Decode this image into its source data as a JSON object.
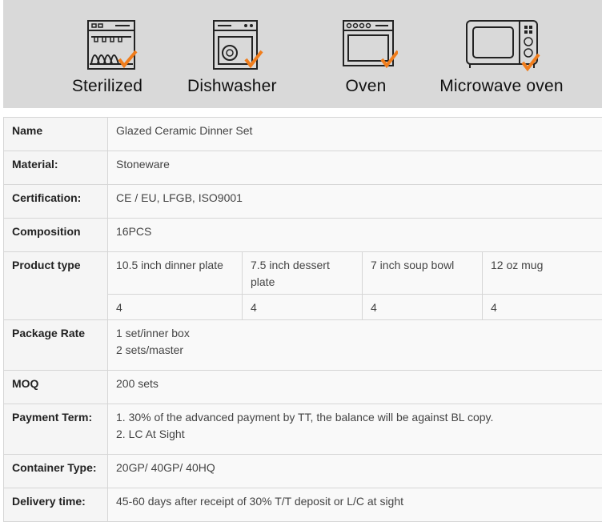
{
  "banner": {
    "features": [
      {
        "label": "Sterilized",
        "icon": "sterilizer-icon"
      },
      {
        "label": "Dishwasher",
        "icon": "dishwasher-icon"
      },
      {
        "label": "Oven",
        "icon": "oven-icon"
      },
      {
        "label": "Microwave oven",
        "icon": "microwave-icon"
      }
    ],
    "check_color": "#f07d1c"
  },
  "specs": {
    "name": {
      "key": "Name",
      "value": "Glazed Ceramic Dinner Set"
    },
    "material": {
      "key": "Material:",
      "value": "Stoneware"
    },
    "certification": {
      "key": "Certification:",
      "value": "CE / EU, LFGB, ISO9001"
    },
    "composition": {
      "key": "Composition",
      "value": "16PCS"
    },
    "product_type": {
      "key": "Product type",
      "items": [
        {
          "name": "10.5 inch  dinner plate",
          "qty": "4"
        },
        {
          "name": "7.5 inch dessert plate",
          "qty": "4"
        },
        {
          "name": "7 inch soup bowl",
          "qty": "4"
        },
        {
          "name": "12 oz mug",
          "qty": "4"
        }
      ]
    },
    "package_rate": {
      "key": "Package Rate",
      "lines": [
        "1 set/inner box",
        "2 sets/master"
      ]
    },
    "moq": {
      "key": "MOQ",
      "value": "200 sets"
    },
    "payment_term": {
      "key": "Payment Term:",
      "lines": [
        "1. 30% of the advanced payment by TT, the balance will be against BL copy.",
        "2. LC At Sight"
      ]
    },
    "container_type": {
      "key": "Container Type:",
      "value": "20GP/ 40GP/ 40HQ"
    },
    "delivery_time": {
      "key": "Delivery time:",
      "value": "45-60 days after receipt of 30% T/T deposit or L/C at sight"
    }
  }
}
